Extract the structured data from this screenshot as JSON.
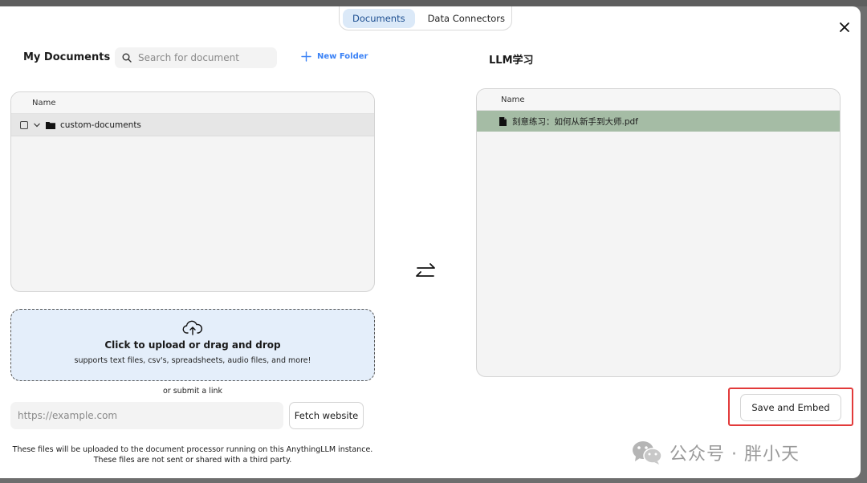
{
  "tabs": [
    {
      "label": "Documents",
      "active": true
    },
    {
      "label": "Data Connectors",
      "active": false
    }
  ],
  "left": {
    "title": "My Documents",
    "search_placeholder": "Search for document",
    "new_folder_label": "New Folder",
    "column_header": "Name",
    "folders": [
      {
        "name": "custom-documents",
        "expanded": true
      }
    ]
  },
  "right": {
    "title": "LLM学习",
    "column_header": "Name",
    "files": [
      {
        "name": "刻意练习：如何从新手到大师.pdf",
        "highlight_color": "#a5bca5"
      }
    ]
  },
  "upload": {
    "title": "Click to upload or drag and drop",
    "subtitle": "supports text files, csv's, spreadsheets, audio files, and more!",
    "icon": "cloud-upload-icon"
  },
  "link": {
    "or_label": "or submit a link",
    "placeholder": "https://example.com",
    "fetch_label": "Fetch website"
  },
  "notice": {
    "line1": "These files will be uploaded to the document processor running on this AnythingLLM instance.",
    "line2": "These files are not sent or shared with a third party."
  },
  "actions": {
    "save_label": "Save and Embed"
  },
  "watermark": {
    "text": "公众号 · 胖小天"
  },
  "colors": {
    "accent": "#3b82f6",
    "active_tab_bg": "#dbe9f8",
    "upload_bg": "#e4eefa",
    "highlight_outline": "#e23a3a"
  }
}
